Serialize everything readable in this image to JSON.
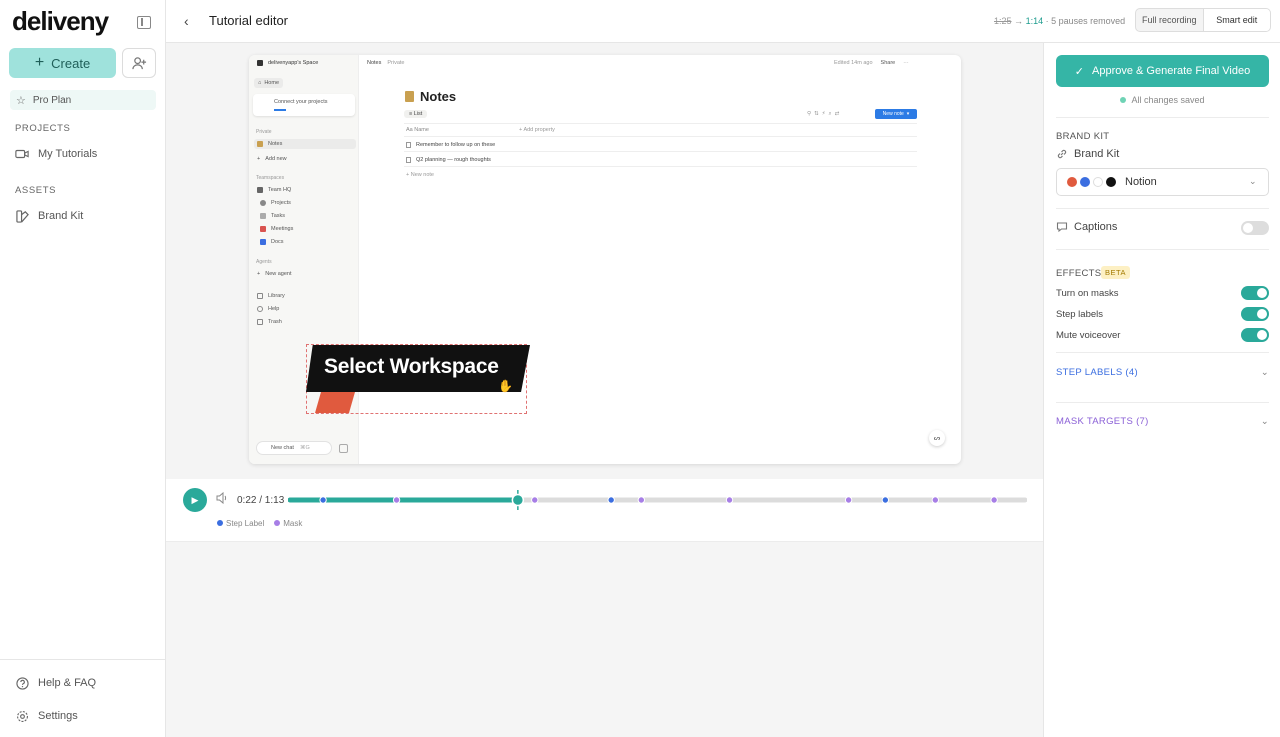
{
  "app": {
    "logo": "deliveny"
  },
  "sidebar": {
    "create_label": "Create",
    "pro_plan": "Pro Plan",
    "projects_heading": "PROJECTS",
    "projects": [
      {
        "label": "My Tutorials"
      }
    ],
    "assets_heading": "ASSETS",
    "assets": [
      {
        "label": "Brand Kit"
      }
    ],
    "footer": [
      {
        "label": "Help & FAQ"
      },
      {
        "label": "Settings"
      }
    ]
  },
  "header": {
    "title": "Tutorial editor",
    "duration_old": "1:25",
    "arrow": "→",
    "duration_new": "1:14",
    "pauses_note": "· 5 pauses removed",
    "modes": [
      "Full recording",
      "Smart edit"
    ],
    "active_mode": "Smart edit"
  },
  "preview": {
    "workspace_name": "deliveny​app's Space",
    "breadcrumb_notes": "Notes",
    "breadcrumb_private": "Private",
    "edited": "Edited 14m ago",
    "share": "Share",
    "side": {
      "home": "Home",
      "connect": "Connect your projects",
      "private_label": "Private",
      "notes": "Notes",
      "add_new": "Add new",
      "teamspaces_label": "Teamspaces",
      "team_hq": "Team HQ",
      "projects": "Projects",
      "tasks": "Tasks",
      "meetings": "Meetings",
      "docs": "Docs",
      "agents_label": "Agents",
      "new_agent": "New agent",
      "library": "Library",
      "help": "Help",
      "trash": "Trash",
      "new_chat": "New chat",
      "shortcut": "⌘G"
    },
    "page_title": "Notes",
    "view_tab": "List",
    "new_note_button": "New note",
    "col_name": "Name",
    "add_property": "Add property",
    "rows": [
      "Remember to follow up on these",
      "Q2 planning — rough thoughts"
    ],
    "new_note_row": "New note",
    "overlay_text": "Select Workspace"
  },
  "timeline": {
    "time": "0:22 / 1:13",
    "progress": 0.31,
    "legend": [
      {
        "label": "Step Label",
        "color": "#3b6ee0"
      },
      {
        "label": "Mask",
        "color": "#a77ee6"
      }
    ],
    "markers": [
      {
        "type": "step",
        "pos": 0.045
      },
      {
        "type": "mask",
        "pos": 0.145
      },
      {
        "type": "mask",
        "pos": 0.333
      },
      {
        "type": "step",
        "pos": 0.437
      },
      {
        "type": "mask",
        "pos": 0.478
      },
      {
        "type": "mask",
        "pos": 0.598
      },
      {
        "type": "mask",
        "pos": 0.76
      },
      {
        "type": "step",
        "pos": 0.81
      },
      {
        "type": "mask",
        "pos": 0.878
      },
      {
        "type": "mask",
        "pos": 0.958
      }
    ]
  },
  "panel": {
    "approve_label": "Approve & Generate Final Video",
    "saved_label": "All changes saved",
    "brand_kit_heading": "BRAND KIT",
    "brand_kit_label": "Brand Kit",
    "brand_select": "Notion",
    "brand_swatches": [
      "#e05a3e",
      "#3b6ee0",
      "#ffffff",
      "#111111"
    ],
    "captions_label": "Captions",
    "captions_on": false,
    "effects_heading": "EFFECTS",
    "beta": "BETA",
    "effects": [
      {
        "label": "Turn on masks",
        "on": true
      },
      {
        "label": "Step labels",
        "on": true
      },
      {
        "label": "Mute voiceover",
        "on": true
      }
    ],
    "step_labels_heading": "STEP LABELS (4)",
    "mask_targets_heading": "MASK TARGETS (7)"
  },
  "colors": {
    "accent": "#2aa99a",
    "step": "#3b6ee0",
    "mask": "#a77ee6"
  }
}
